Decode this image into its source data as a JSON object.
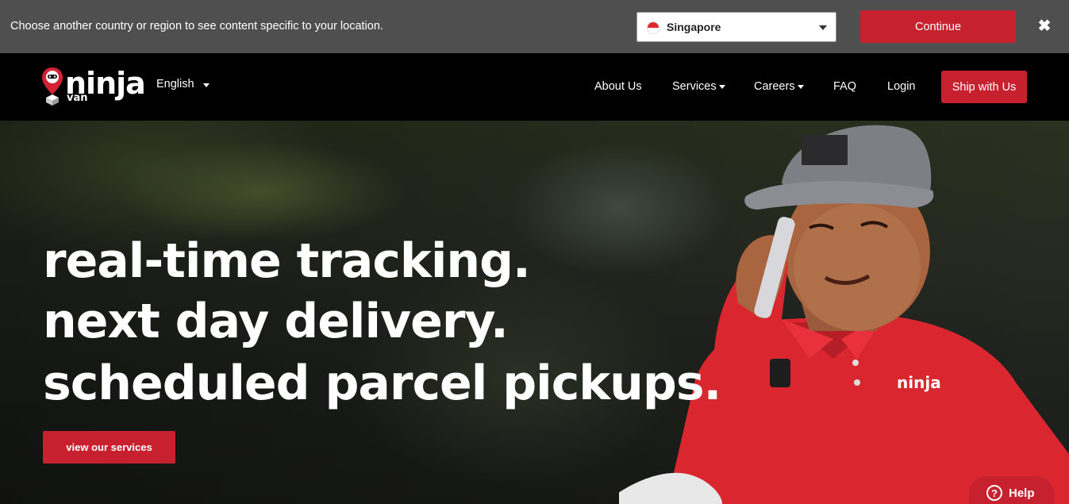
{
  "region_banner": {
    "message": "Choose another country or region to see content specific to your location.",
    "selected_country": "Singapore",
    "continue_label": "Continue",
    "close_symbol": "✖"
  },
  "nav": {
    "logo_text": "ninja",
    "logo_sub": "van",
    "language": "English",
    "links": [
      "About Us",
      "Services",
      "Careers",
      "FAQ",
      "Login"
    ],
    "cta": "Ship with Us"
  },
  "hero": {
    "lines": [
      "real-time tracking.",
      "next day delivery.",
      "scheduled parcel pickups."
    ],
    "button": "view our services"
  },
  "help": {
    "label": "Help",
    "icon_glyph": "?"
  },
  "colors": {
    "brand_red": "#c72130",
    "banner_bg": "#4f4f4f",
    "nav_bg": "#000000"
  }
}
